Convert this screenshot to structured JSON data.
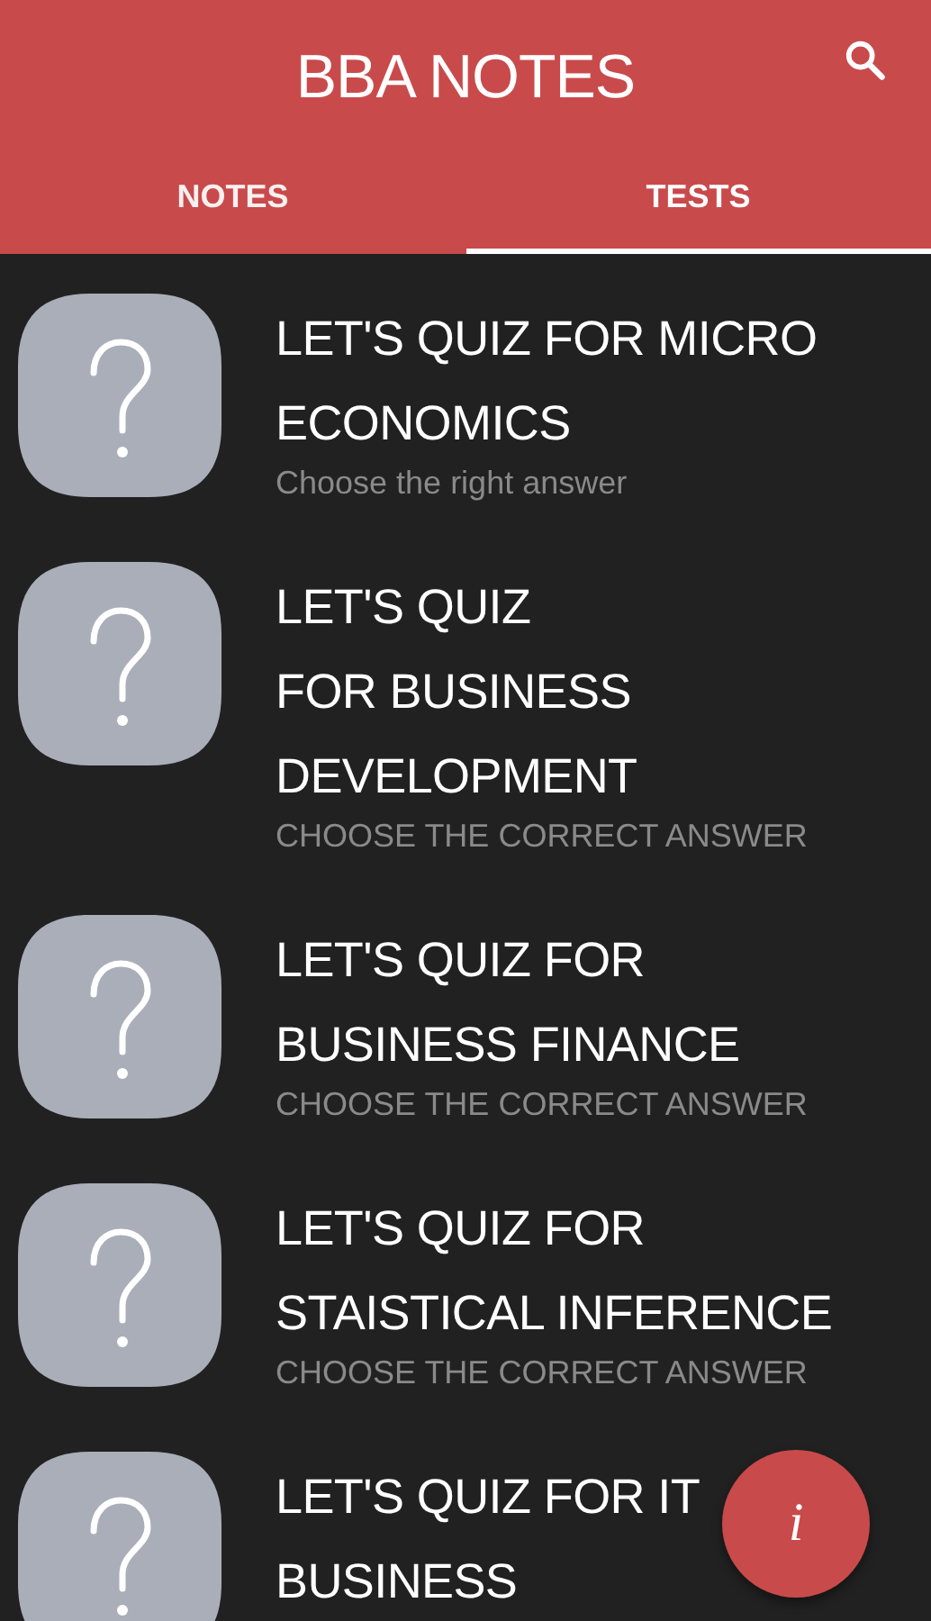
{
  "app_bar": {
    "title": "BBA NOTES"
  },
  "tabs": [
    {
      "label": "NOTES",
      "selected": false
    },
    {
      "label": "TESTS",
      "selected": true
    }
  ],
  "quizzes": [
    {
      "title": [
        "LET'S QUIZ FOR MICRO",
        "ECONOMICS"
      ],
      "subtitle": "Choose the right answer"
    },
    {
      "title": [
        "LET'S QUIZ",
        "FOR BUSINESS",
        "DEVELOPMENT"
      ],
      "subtitle": "CHOOSE THE CORRECT ANSWER"
    },
    {
      "title": [
        "LET'S QUIZ FOR",
        "BUSINESS FINANCE"
      ],
      "subtitle": "CHOOSE THE CORRECT ANSWER"
    },
    {
      "title": [
        "LET'S QUIZ FOR",
        "STAISTICAL INFERENCE"
      ],
      "subtitle": "CHOOSE THE CORRECT ANSWER"
    },
    {
      "title": [
        "LET'S QUIZ FOR IT",
        "BUSINESS"
      ]
    }
  ],
  "fab": {
    "label": "i"
  }
}
